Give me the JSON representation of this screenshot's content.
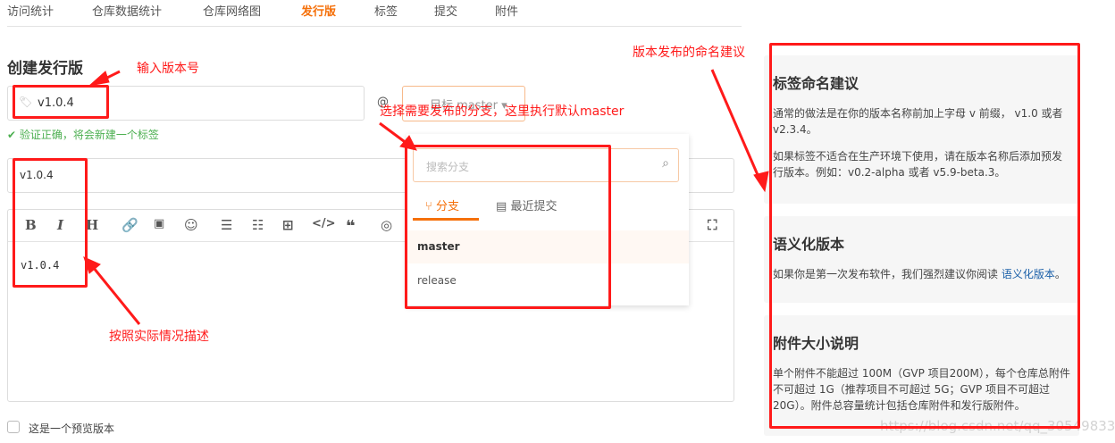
{
  "nav": {
    "tabs": [
      "访问统计",
      "仓库数据统计",
      "仓库网络图",
      "发行版",
      "标签",
      "提交",
      "附件"
    ],
    "active": 3
  },
  "form": {
    "title": "创建发行版",
    "tag_value": "v1.0.4",
    "at": "@",
    "branch_button": "目标 master",
    "validation": "验证正确，将会新建一个标签",
    "release_title": "v1.0.4",
    "editor_content": "v1.0.4",
    "prerelease_label": "这是一个预览版本"
  },
  "toolbar": {
    "bold": "B",
    "italic": "I",
    "heading": "H"
  },
  "dropdown": {
    "search_placeholder": "搜索分支",
    "tab_branches": "分支",
    "tab_commits": "最近提交",
    "branches": [
      "master",
      "release"
    ]
  },
  "sidebar": {
    "naming_title": "标签命名建议",
    "naming_p1": "通常的做法是在你的版本名称前加上字母 v 前缀， v1.0 或者 v2.3.4。",
    "naming_p2": "如果标签不适合在生产环境下使用，请在版本名称后添加预发行版本。例如：v0.2-alpha 或者 v5.9-beta.3。",
    "semver_title": "语义化版本",
    "semver_p": "如果你是第一次发布软件，我们强烈建议你阅读 ",
    "semver_link": "语义化版本",
    "semver_end": "。",
    "size_title": "附件大小说明",
    "size_p": "单个附件不能超过 100M（GVP 项目200M），每个仓库总附件不可超过 1G（推荐项目不可超过 5G；GVP 项目不可超过 20G）。附件总容量统计包括仓库附件和发行版附件。"
  },
  "annotations": {
    "version": "输入版本号",
    "branch": "选择需要发布的分支，这里执行默认master",
    "naming": "版本发布的命名建议",
    "describe": "按照实际情况描述"
  },
  "watermark": "https://blog.csdn.net/qq_30549833",
  "colors": {
    "accent": "#f5700a",
    "annotation": "#ff1a1a",
    "success": "#4caf50"
  }
}
